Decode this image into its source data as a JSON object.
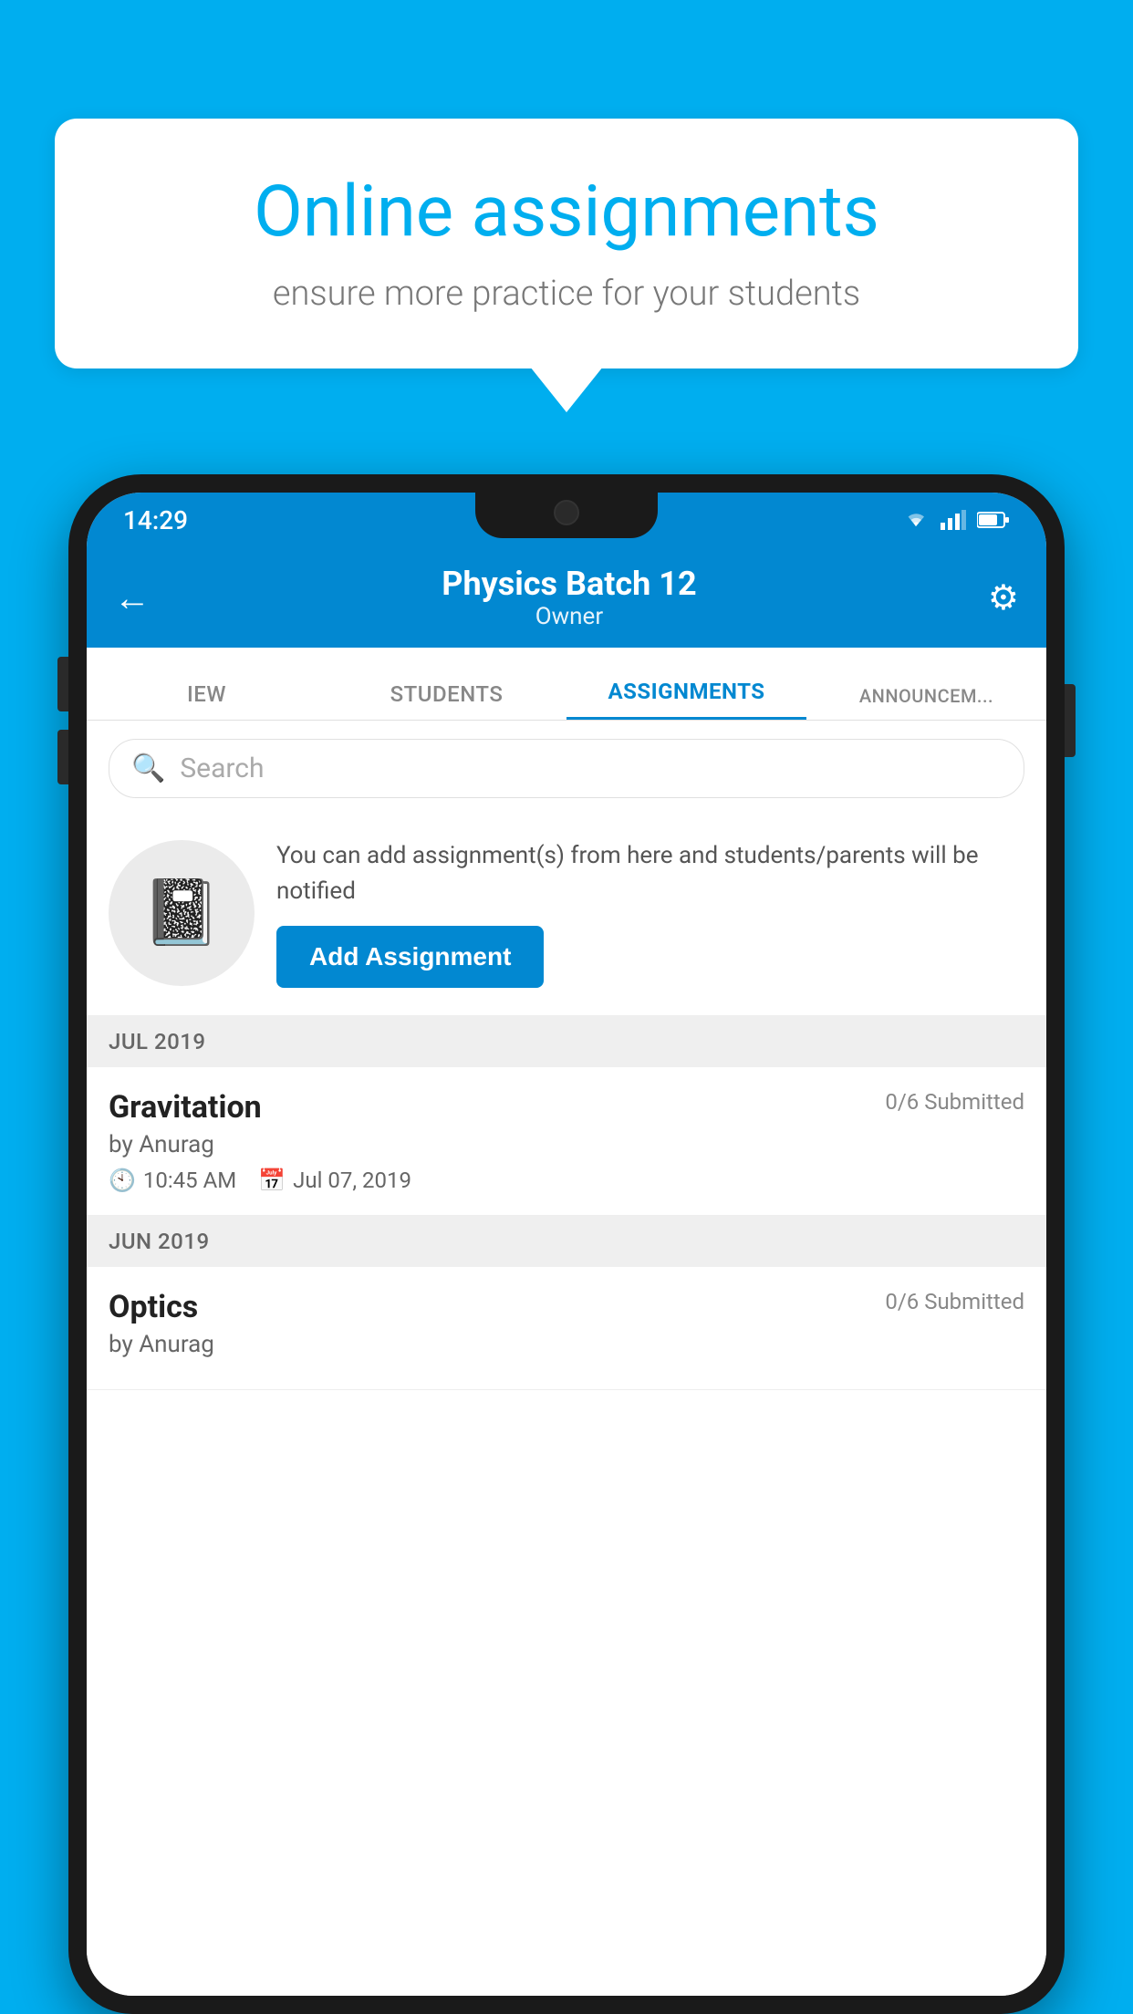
{
  "background_color": "#00AEEF",
  "speech_bubble": {
    "title": "Online assignments",
    "subtitle": "ensure more practice for your students"
  },
  "status_bar": {
    "time": "14:29"
  },
  "header": {
    "title": "Physics Batch 12",
    "subtitle": "Owner"
  },
  "tabs": [
    {
      "label": "IEW",
      "active": false
    },
    {
      "label": "STUDENTS",
      "active": false
    },
    {
      "label": "ASSIGNMENTS",
      "active": true
    },
    {
      "label": "ANNOUNCEM...",
      "active": false
    }
  ],
  "search": {
    "placeholder": "Search"
  },
  "promo": {
    "text": "You can add assignment(s) from here and students/parents will be notified",
    "button_label": "Add Assignment"
  },
  "sections": [
    {
      "label": "JUL 2019",
      "assignments": [
        {
          "title": "Gravitation",
          "submitted": "0/6 Submitted",
          "by": "by Anurag",
          "time": "10:45 AM",
          "date": "Jul 07, 2019"
        }
      ]
    },
    {
      "label": "JUN 2019",
      "assignments": [
        {
          "title": "Optics",
          "submitted": "0/6 Submitted",
          "by": "by Anurag",
          "time": "",
          "date": ""
        }
      ]
    }
  ]
}
